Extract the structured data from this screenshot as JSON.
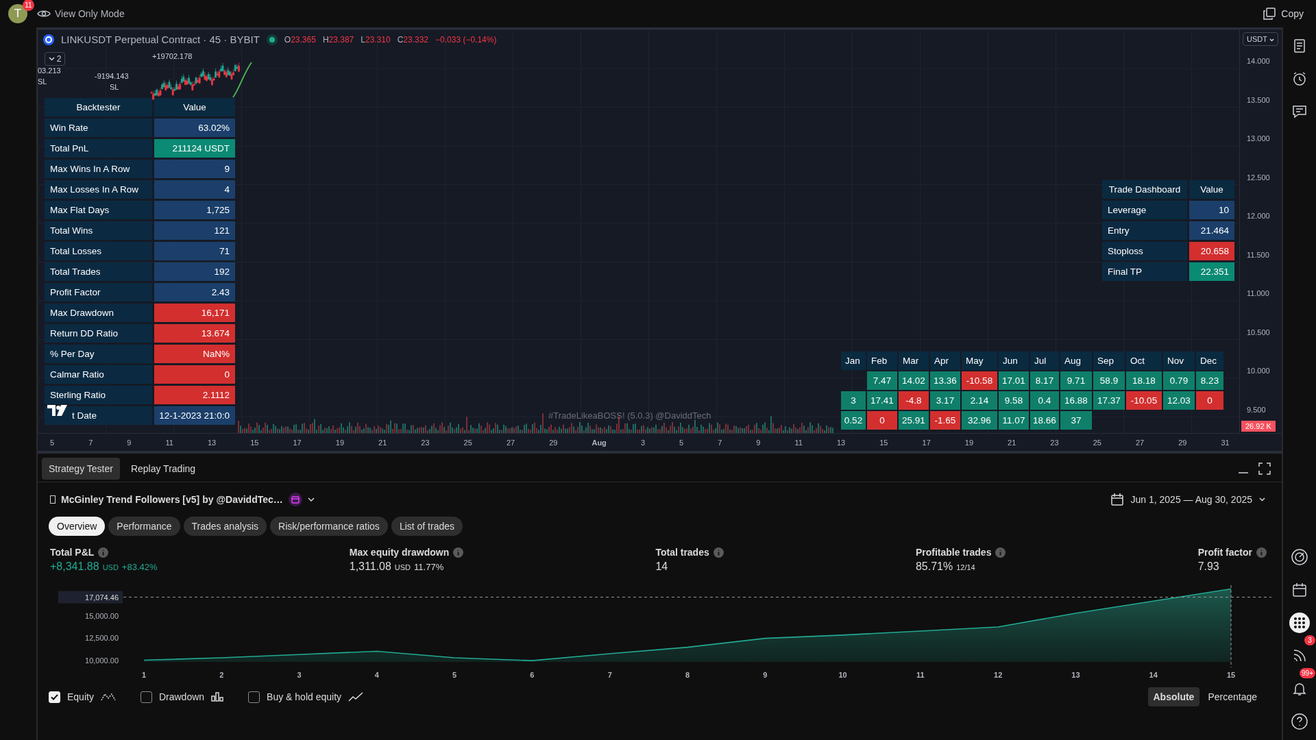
{
  "top_bar": {
    "avatar": "T",
    "badge": "11",
    "mode": "View Only Mode",
    "copy": "Copy"
  },
  "chart": {
    "symbol": "LINKUSDT Perpetual Contract · 45 · BYBIT",
    "live": true,
    "ohlc": [
      {
        "key": "O",
        "value": "23.365"
      },
      {
        "key": "H",
        "value": "23.387"
      },
      {
        "key": "L",
        "value": "23.310"
      },
      {
        "key": "C",
        "value": "23.332"
      }
    ],
    "change": "−0.033 (−0.14%)",
    "collapse": "2",
    "labels": [
      "+19702.178",
      "03.213",
      "SL",
      "-9194.143",
      "SL"
    ],
    "currency": "USDT",
    "price_axis": [
      "14.000",
      "13.500",
      "13.000",
      "12.500",
      "12.000",
      "11.500",
      "11.000",
      "10.500",
      "10.000",
      "9.500"
    ],
    "last_volume": "26.92 K",
    "time_axis": [
      "5",
      "7",
      "9",
      "11",
      "13",
      "15",
      "17",
      "19",
      "21",
      "23",
      "25",
      "27",
      "29",
      "Aug",
      "3",
      "5",
      "7",
      "9",
      "11",
      "13",
      "15",
      "17",
      "19",
      "21",
      "23",
      "25",
      "27",
      "29",
      "31"
    ],
    "watermark": "#TradeLikeaBOSS! (5.0.3) @DaviddTech"
  },
  "backtester": {
    "columns": [
      "Backtester",
      "Value"
    ],
    "rows": [
      {
        "label": "Win Rate",
        "value": "63.02%",
        "color": "#1b3f6a"
      },
      {
        "label": "Total PnL",
        "value": "211124 USDT",
        "color": "#0b8a74"
      },
      {
        "label": "Max Wins In A Row",
        "value": "9",
        "color": "#1b3f6a"
      },
      {
        "label": "Max Losses In A Row",
        "value": "4",
        "color": "#1b3f6a"
      },
      {
        "label": "Max Flat Days",
        "value": "1,725",
        "color": "#1b3f6a"
      },
      {
        "label": "Total Wins",
        "value": "121",
        "color": "#1b3f6a"
      },
      {
        "label": "Total Losses",
        "value": "71",
        "color": "#1b3f6a"
      },
      {
        "label": "Total Trades",
        "value": "192",
        "color": "#1b3f6a"
      },
      {
        "label": "Profit Factor",
        "value": "2.43",
        "color": "#1b3f6a"
      },
      {
        "label": "Max Drawdown",
        "value": "16,171",
        "color": "#d32f2f"
      },
      {
        "label": "Return DD Ratio",
        "value": "13.674",
        "color": "#d32f2f"
      },
      {
        "label": "% Per Day",
        "value": "NaN%",
        "color": "#d32f2f"
      },
      {
        "label": "Calmar Ratio",
        "value": "0",
        "color": "#d32f2f"
      },
      {
        "label": "Sterling Ratio",
        "value": "2.1112",
        "color": "#d32f2f"
      },
      {
        "label": "t Date",
        "value": "12-1-2023 21:0:0",
        "color": "#1b3f6a"
      }
    ]
  },
  "trade_dashboard": {
    "columns": [
      "Trade Dashboard",
      "Value"
    ],
    "rows": [
      {
        "label": "Leverage",
        "value": "10",
        "color": "#1b3f6a"
      },
      {
        "label": "Entry",
        "value": "21.464",
        "color": "#1b3f6a"
      },
      {
        "label": "Stoploss",
        "value": "20.658",
        "color": "#d32f2f"
      },
      {
        "label": "Final TP",
        "value": "22.351",
        "color": "#0b8a74"
      }
    ]
  },
  "monthly": {
    "months": [
      "Jan",
      "Feb",
      "Mar",
      "Apr",
      "May",
      "Jun",
      "Jul",
      "Aug",
      "Sep",
      "Oct",
      "Nov",
      "Dec"
    ],
    "rows": [
      {
        "cells": [
          {},
          {
            "value": "7.47",
            "color": "#0f7f6a"
          },
          {
            "value": "14.02",
            "color": "#0f7f6a"
          },
          {
            "value": "13.36",
            "color": "#0f7f6a"
          },
          {
            "value": "-10.58",
            "color": "#d32f2f"
          },
          {
            "value": "17.01",
            "color": "#0f7f6a"
          },
          {
            "value": "8.17",
            "color": "#0f7f6a"
          },
          {
            "value": "9.71",
            "color": "#0f7f6a"
          },
          {
            "value": "58.9",
            "color": "#0f7f6a"
          },
          {
            "value": "18.18",
            "color": "#0f7f6a"
          },
          {
            "value": "0.79",
            "color": "#0f7f6a"
          },
          {
            "value": "8.23",
            "color": "#0f7f6a"
          }
        ]
      },
      {
        "cells": [
          {
            "value": "3",
            "color": "#0f7f6a"
          },
          {
            "value": "17.41",
            "color": "#0f7f6a"
          },
          {
            "value": "-4.8",
            "color": "#d32f2f"
          },
          {
            "value": "3.17",
            "color": "#0f7f6a"
          },
          {
            "value": "2.14",
            "color": "#0f7f6a"
          },
          {
            "value": "9.58",
            "color": "#0f7f6a"
          },
          {
            "value": "0.4",
            "color": "#0f7f6a"
          },
          {
            "value": "16.88",
            "color": "#0f7f6a"
          },
          {
            "value": "17.37",
            "color": "#0f7f6a"
          },
          {
            "value": "-10.05",
            "color": "#d32f2f"
          },
          {
            "value": "12.03",
            "color": "#0f7f6a"
          },
          {
            "value": "0",
            "color": "#d32f2f"
          }
        ]
      },
      {
        "cells": [
          {
            "value": "0.52",
            "color": "#0f7f6a"
          },
          {
            "value": "0",
            "color": "#d32f2f"
          },
          {
            "value": "25.91",
            "color": "#0f7f6a"
          },
          {
            "value": "-1.65",
            "color": "#d32f2f"
          },
          {
            "value": "32.96",
            "color": "#0f7f6a"
          },
          {
            "value": "11.07",
            "color": "#0f7f6a"
          },
          {
            "value": "18.66",
            "color": "#0f7f6a"
          },
          {
            "value": "37",
            "color": "#0f7f6a"
          }
        ]
      }
    ]
  },
  "strategy_tester": {
    "tabs": [
      {
        "label": "Strategy Tester",
        "selected": true
      },
      {
        "label": "Replay Trading",
        "selected": false
      }
    ],
    "strategy": "McGinley Trend Followers [v5] by @DaviddTec…",
    "date_range": "Jun 1, 2025 — Aug 30, 2025",
    "views": [
      {
        "label": "Overview",
        "selected": true
      },
      {
        "label": "Performance",
        "selected": false
      },
      {
        "label": "Trades analysis",
        "selected": false
      },
      {
        "label": "Risk/performance ratios",
        "selected": false
      },
      {
        "label": "List of trades",
        "selected": false
      }
    ],
    "metrics": [
      {
        "label": "Total P&L",
        "value": "+8,341.88",
        "unit": "USD",
        "extra": "+83.42%",
        "color": "#22ab94"
      },
      {
        "label": "Max equity drawdown",
        "value": "1,311.08",
        "unit": "USD",
        "extra": "11.77%",
        "color": "#dbdbdb"
      },
      {
        "label": "Total trades",
        "value": "14",
        "color": "#dbdbdb"
      },
      {
        "label": "Profitable trades",
        "value": "85.71%",
        "extra": "12/14",
        "color": "#dbdbdb"
      },
      {
        "label": "Profit factor",
        "value": "7.93",
        "color": "#dbdbdb"
      }
    ],
    "chart_data": {
      "type": "area",
      "x": [
        1,
        2,
        3,
        4,
        5,
        6,
        7,
        8,
        9,
        10,
        11,
        12,
        13,
        14,
        15
      ],
      "series": [
        {
          "color": "#22ab94",
          "values": [
            10000,
            10270,
            10640,
            11000,
            10270,
            9950,
            10730,
            11450,
            12450,
            12820,
            13270,
            13730,
            15270,
            16640,
            18000
          ]
        }
      ],
      "xlim": [
        1,
        15
      ],
      "ylim": [
        9500,
        18500
      ],
      "yticks": [
        {
          "value": 10000,
          "label": "10,000.00"
        },
        {
          "value": 12500,
          "label": "12,500.00"
        },
        {
          "value": 15000,
          "label": "15,000.00"
        },
        {
          "value": 17074.46,
          "label": "17,074.46"
        }
      ],
      "xticks": [
        1,
        2,
        3,
        4,
        5,
        6,
        7,
        8,
        9,
        10,
        11,
        12,
        13,
        14,
        15
      ]
    },
    "series_toggles": [
      {
        "label": "Equity",
        "checked": true,
        "kind": "equity"
      },
      {
        "label": "Drawdown",
        "checked": false,
        "kind": "drawdown"
      },
      {
        "label": "Buy & hold equity",
        "checked": false,
        "kind": "buyhold"
      }
    ],
    "modes": [
      {
        "label": "Absolute",
        "selected": true
      },
      {
        "label": "Percentage",
        "selected": false
      }
    ]
  },
  "side_toolbar": {
    "top": [
      {
        "kind": "list"
      },
      {
        "kind": "alarm"
      },
      {
        "kind": "chat"
      }
    ],
    "bottom": [
      {
        "kind": "gauge"
      },
      {
        "kind": "calendar"
      },
      {
        "kind": "grid"
      },
      {
        "kind": "feed",
        "badge": "3"
      },
      {
        "kind": "bell",
        "badge": "99+"
      },
      {
        "kind": "help"
      }
    ]
  }
}
